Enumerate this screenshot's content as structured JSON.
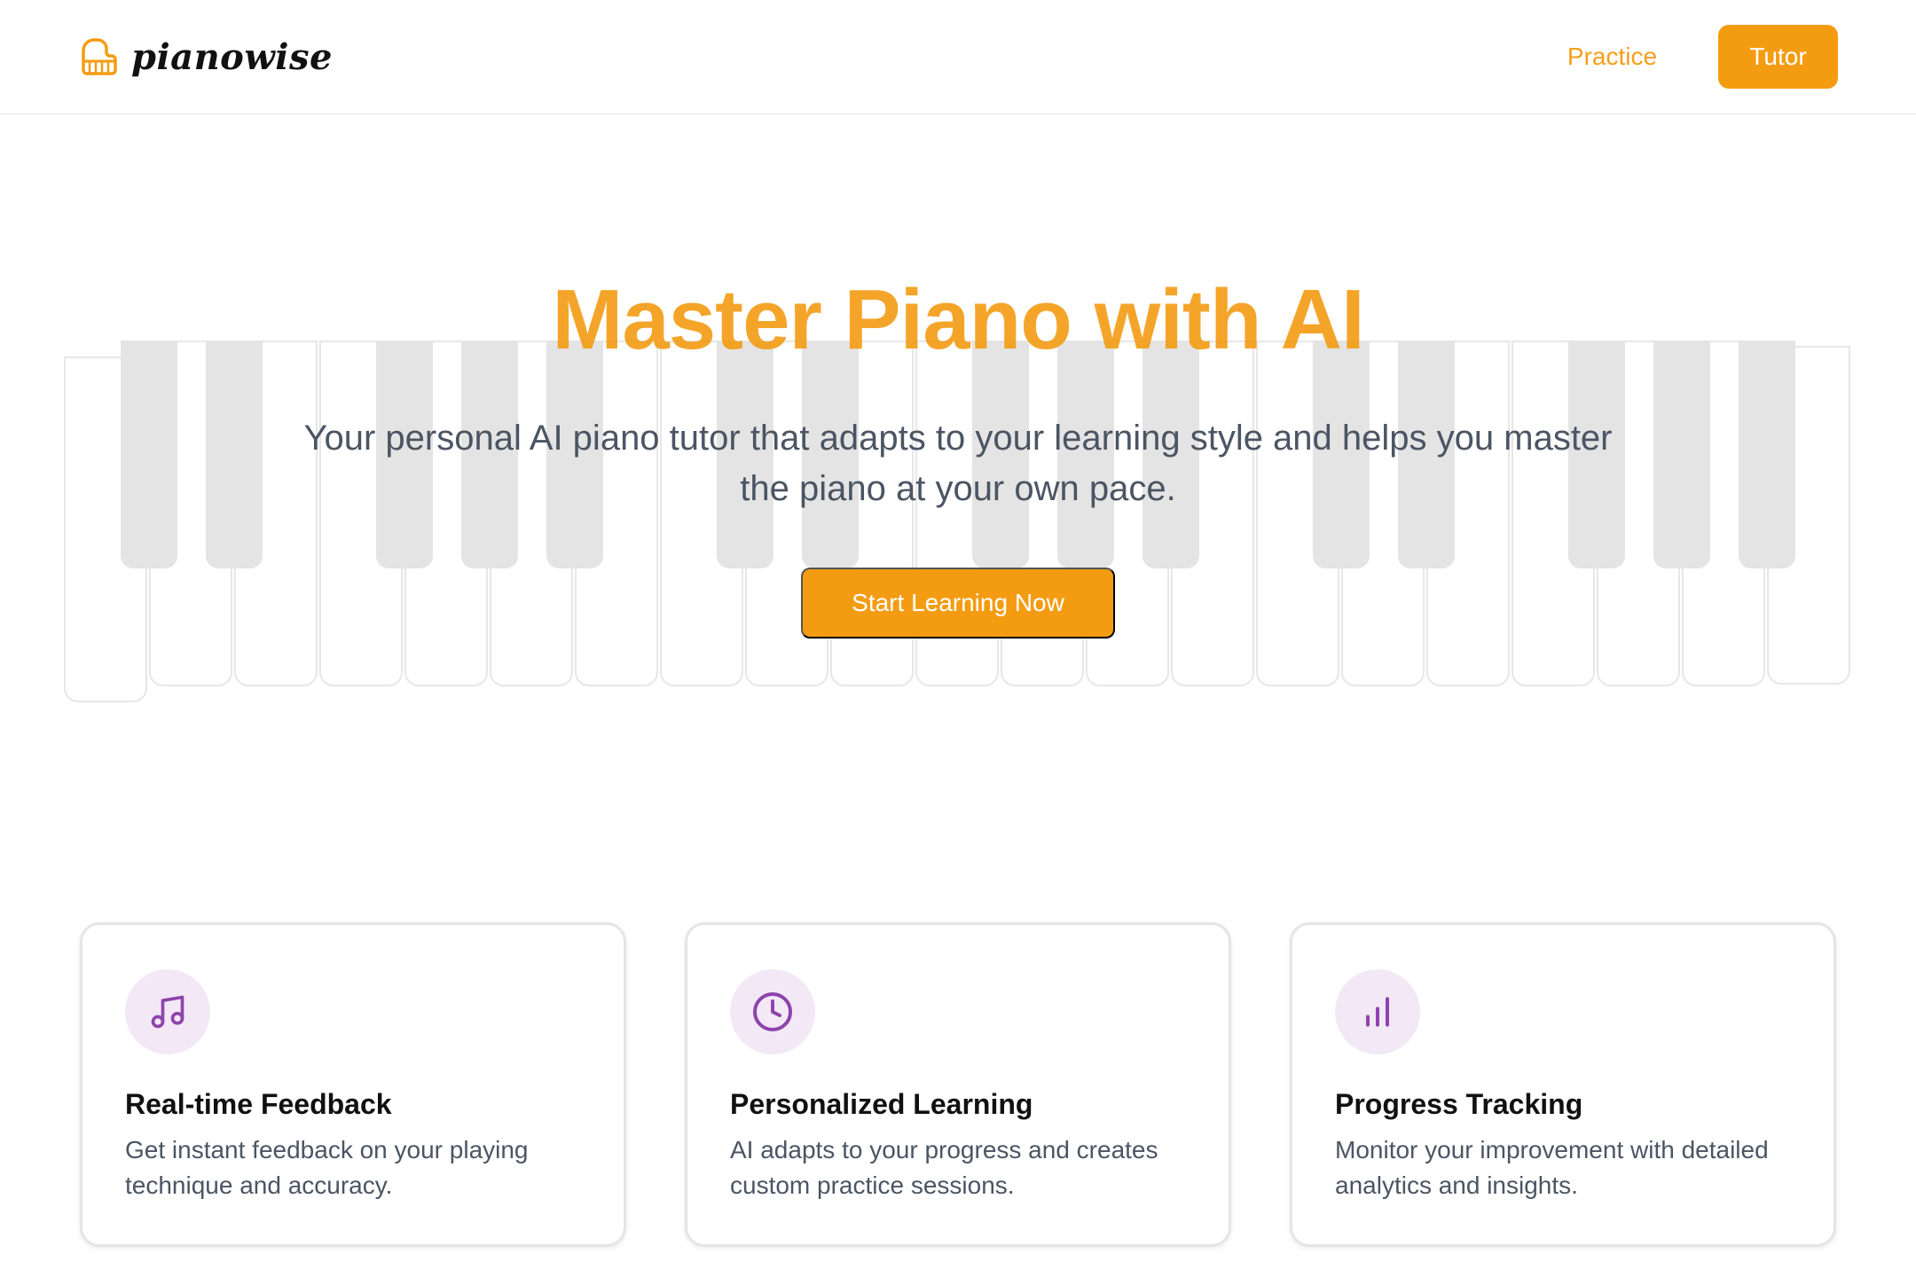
{
  "header": {
    "brand": "pianowise",
    "nav": {
      "practice": "Practice",
      "tutor": "Tutor"
    }
  },
  "hero": {
    "title": "Master Piano with AI",
    "subtitle": "Your personal AI piano tutor that adapts to your learning style and helps you master the piano at your own pace.",
    "cta": "Start Learning Now"
  },
  "features": [
    {
      "icon": "music-note-icon",
      "title": "Real-time Feedback",
      "description": "Get instant feedback on your playing technique and accuracy."
    },
    {
      "icon": "clock-icon",
      "title": "Personalized Learning",
      "description": "AI adapts to your progress and creates custom practice sessions."
    },
    {
      "icon": "bar-chart-icon",
      "title": "Progress Tracking",
      "description": "Monitor your improvement with detailed analytics and insights."
    }
  ],
  "colors": {
    "accent": "#f39c12",
    "icon_purple": "#8e44ad",
    "icon_bg": "#f3e9f6",
    "text_gray": "#4b5563"
  }
}
